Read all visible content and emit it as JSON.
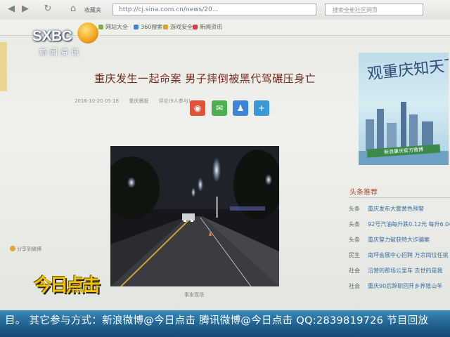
{
  "browser": {
    "address": "http://cj.sina.com.cn/news/20...",
    "search_placeholder": "搜索全能社区网页",
    "back_icon": "back-arrow-icon",
    "forward_icon": "forward-arrow-icon",
    "refresh_icon": "refresh-icon",
    "home_icon": "home-icon",
    "home_label": "收藏夹",
    "bookmarks": [
      "网站大全",
      "360搜索",
      "游戏安全",
      "新闻资讯"
    ]
  },
  "logo": {
    "brand": "SXBC",
    "subtitle": "新闻资讯"
  },
  "article": {
    "headline": "重庆发生一起命案 男子摔倒被黑代驾碾压身亡",
    "date": "2016-10-20 05:18",
    "source": "重庆晨报",
    "comments": "评论(9人参与)",
    "share_buttons": [
      {
        "name": "weibo-share-button",
        "glyph": "◉",
        "color": "#e0533a"
      },
      {
        "name": "wechat-share-button",
        "glyph": "✉",
        "color": "#4cb050"
      },
      {
        "name": "qq-share-button",
        "glyph": "♟",
        "color": "#3b86d8"
      },
      {
        "name": "more-share-button",
        "glyph": "+",
        "color": "#3b98d6"
      }
    ],
    "photo_caption": "事发现场",
    "share_to_weibo": "分享到微博"
  },
  "sidebar": {
    "ad_title": "观重庆知天下",
    "ad_banner": "新浪重庆官方微博",
    "recommend_title": "头条推荐",
    "items": [
      {
        "tag": "头条",
        "text": "重庆发布大雾黄色预警"
      },
      {
        "tag": "头条",
        "text": "92号汽油每升跌0.12元 每升6.04"
      },
      {
        "tag": "头条",
        "text": "重庆警力破获特大诈骗案"
      },
      {
        "tag": "民生",
        "text": "南坪会展中心招聘 万余岗位任挑"
      },
      {
        "tag": "社会",
        "text": "沿营的那场公里车 去世的是我"
      },
      {
        "tag": "社会",
        "text": "重庆90后辞职回开乡养殖山羊"
      }
    ]
  },
  "overlay": {
    "show_logo": "今日点击",
    "ticker": "目。 其它参与方式：新浪微博@今日点击 腾讯微博@今日点击 QQ:2839819726 节目回放"
  }
}
